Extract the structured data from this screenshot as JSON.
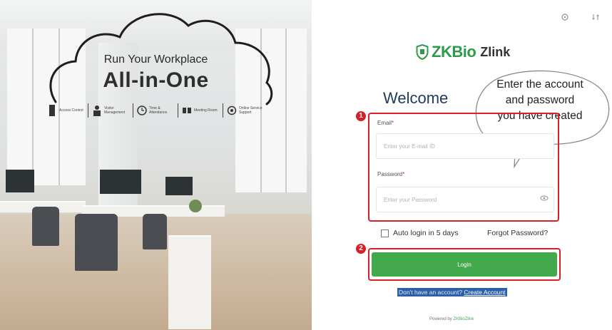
{
  "hero": {
    "subtitle": "Run Your Workplace",
    "title": "All-in-One",
    "features": [
      {
        "icon": "door-icon",
        "label": "Access Control"
      },
      {
        "icon": "visitor-icon",
        "label": "Visitor Management"
      },
      {
        "icon": "clock-icon",
        "label": "Time & Attendance"
      },
      {
        "icon": "book-icon",
        "label": "Meeting Room"
      },
      {
        "icon": "support-icon",
        "label": "Online Service Support"
      }
    ]
  },
  "header": {
    "icons": [
      "settings-icon",
      "language-icon"
    ]
  },
  "logo": {
    "brand_prefix": "ZK",
    "brand_suffix": "Bio",
    "product": "Zlink"
  },
  "welcome": "Welcome",
  "callout": {
    "line1": "Enter the account",
    "line2": "and password",
    "line3": "you have created"
  },
  "steps": {
    "one": "1",
    "two": "2"
  },
  "form": {
    "email_label": "Email",
    "email_placeholder": "Enter your E-mail ID",
    "password_label": "Password",
    "password_placeholder": "Enter your Password",
    "required_mark": "*",
    "auto_login": "Auto login in 5 days",
    "forgot": "Forgot Password?",
    "login": "Login",
    "signup_prompt": "Don't have an account?",
    "signup_link": "Create Account"
  },
  "footer": {
    "powered_by": "Powered by",
    "powered_brand": "ZKBioZlink"
  },
  "colors": {
    "accent_green": "#42a94c",
    "annotation_red": "#d9202a",
    "highlight_blue": "#2d5fa8"
  }
}
